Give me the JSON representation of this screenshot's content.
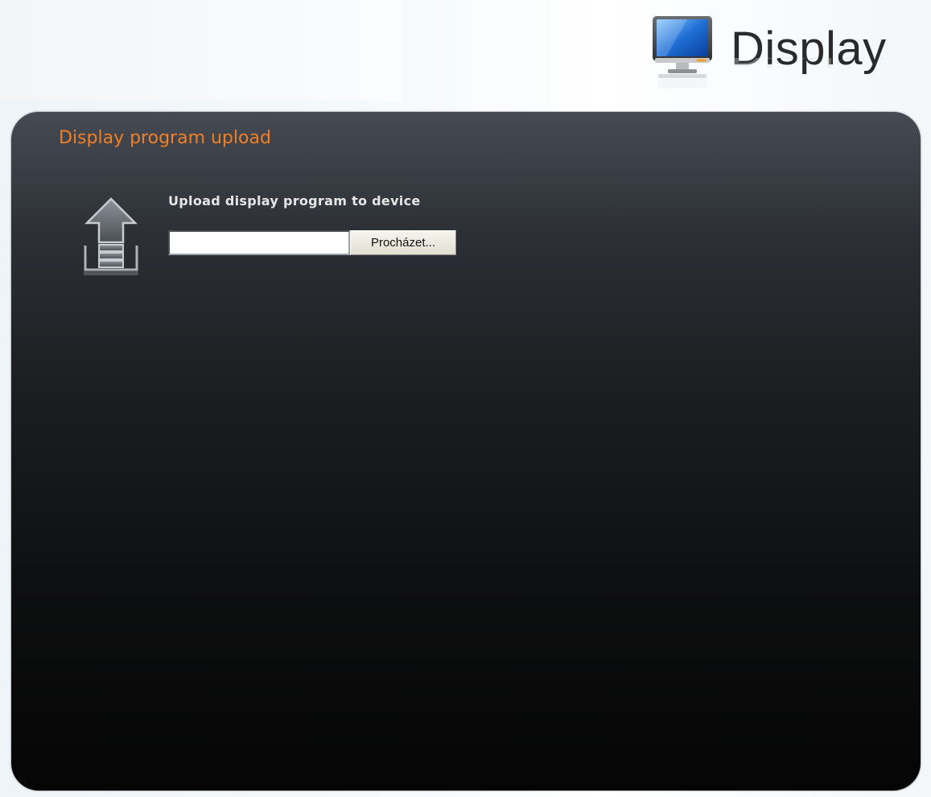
{
  "header": {
    "logo_text": "Display",
    "icon": "monitor-icon"
  },
  "panel": {
    "title": "Display program upload",
    "upload_label": "Upload display program to device",
    "upload_icon": "upload-arrow-icon",
    "file_input_value": "",
    "browse_button_label": "Procházet..."
  },
  "colors": {
    "title_accent": "#f07f25",
    "panel_top": "#464b53",
    "panel_bottom": "#050505"
  }
}
